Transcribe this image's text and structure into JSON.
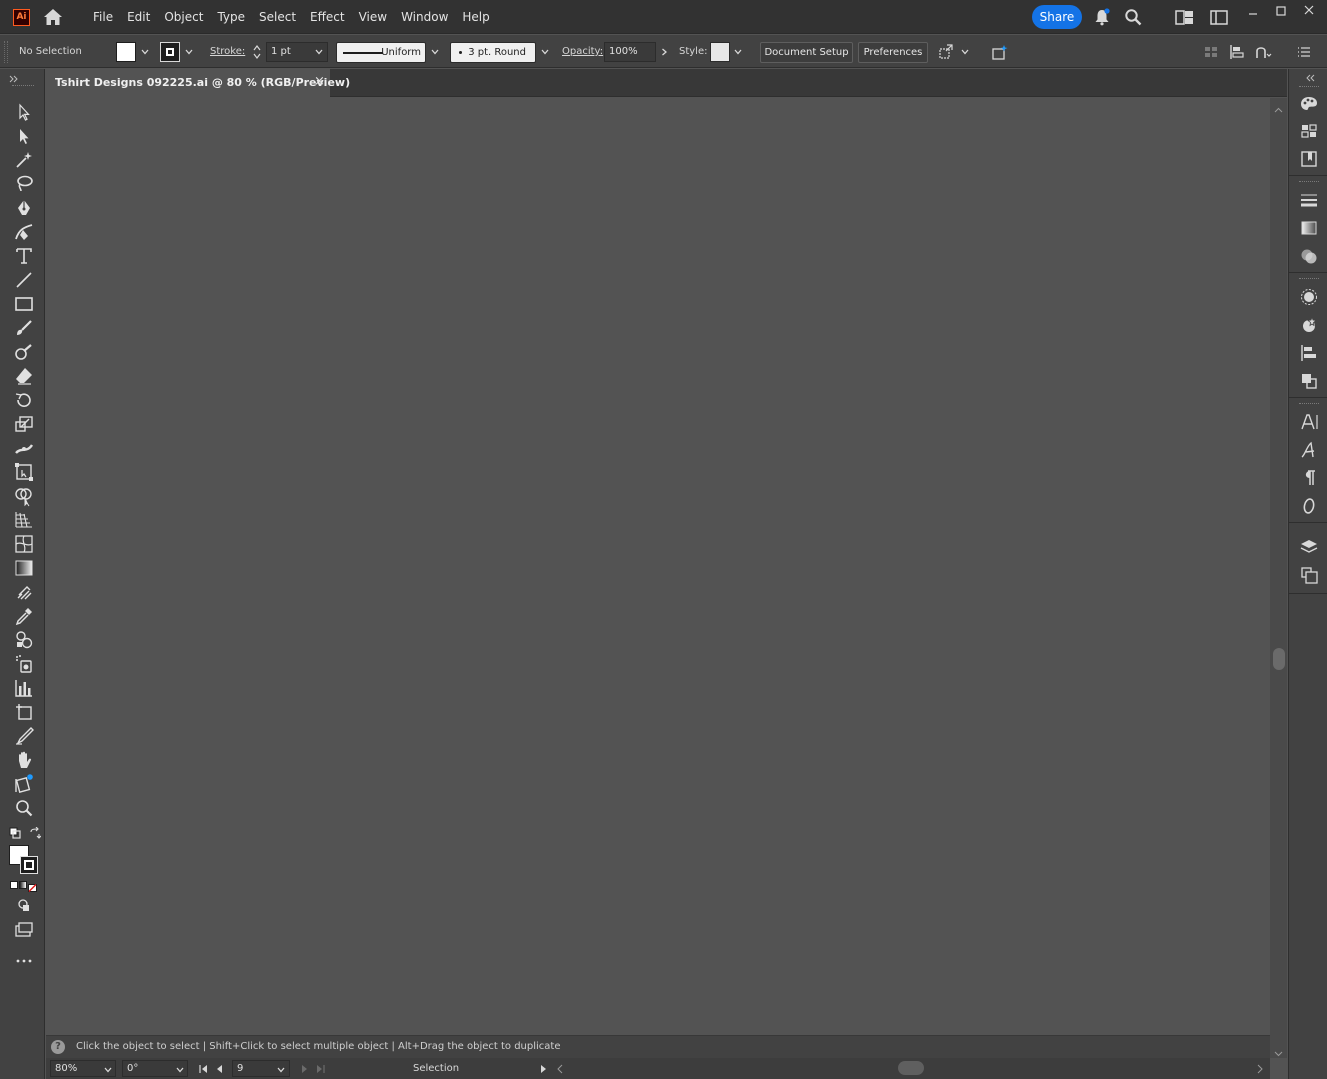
{
  "app": {
    "logo_text": "Ai",
    "menus": [
      "File",
      "Edit",
      "Object",
      "Type",
      "Select",
      "Effect",
      "View",
      "Window",
      "Help"
    ],
    "share_label": "Share"
  },
  "control_bar": {
    "selection_label": "No Selection",
    "stroke_label": "Stroke:",
    "stroke_weight": "1 pt",
    "profile_label": "Uniform",
    "brush_label": "3 pt. Round",
    "opacity_label": "Opacity:",
    "opacity_value": "100%",
    "style_label": "Style:",
    "document_setup_label": "Document Setup",
    "preferences_label": "Preferences"
  },
  "document": {
    "tab_title": "Tshirt Designs 092225.ai @ 80 % (RGB/Preview)",
    "close_glyph": "×"
  },
  "status": {
    "hint": "Click the object to select  |  Shift+Click to select multiple object  |  Alt+Drag the object to duplicate",
    "help_glyph": "?",
    "zoom": "80%",
    "rotation": "0°",
    "artboard": "9",
    "tool_name": "Selection"
  },
  "colors": {
    "accent": "#1473e6",
    "chrome_dark": "#323232",
    "panel": "#424242",
    "canvas": "#535353"
  }
}
